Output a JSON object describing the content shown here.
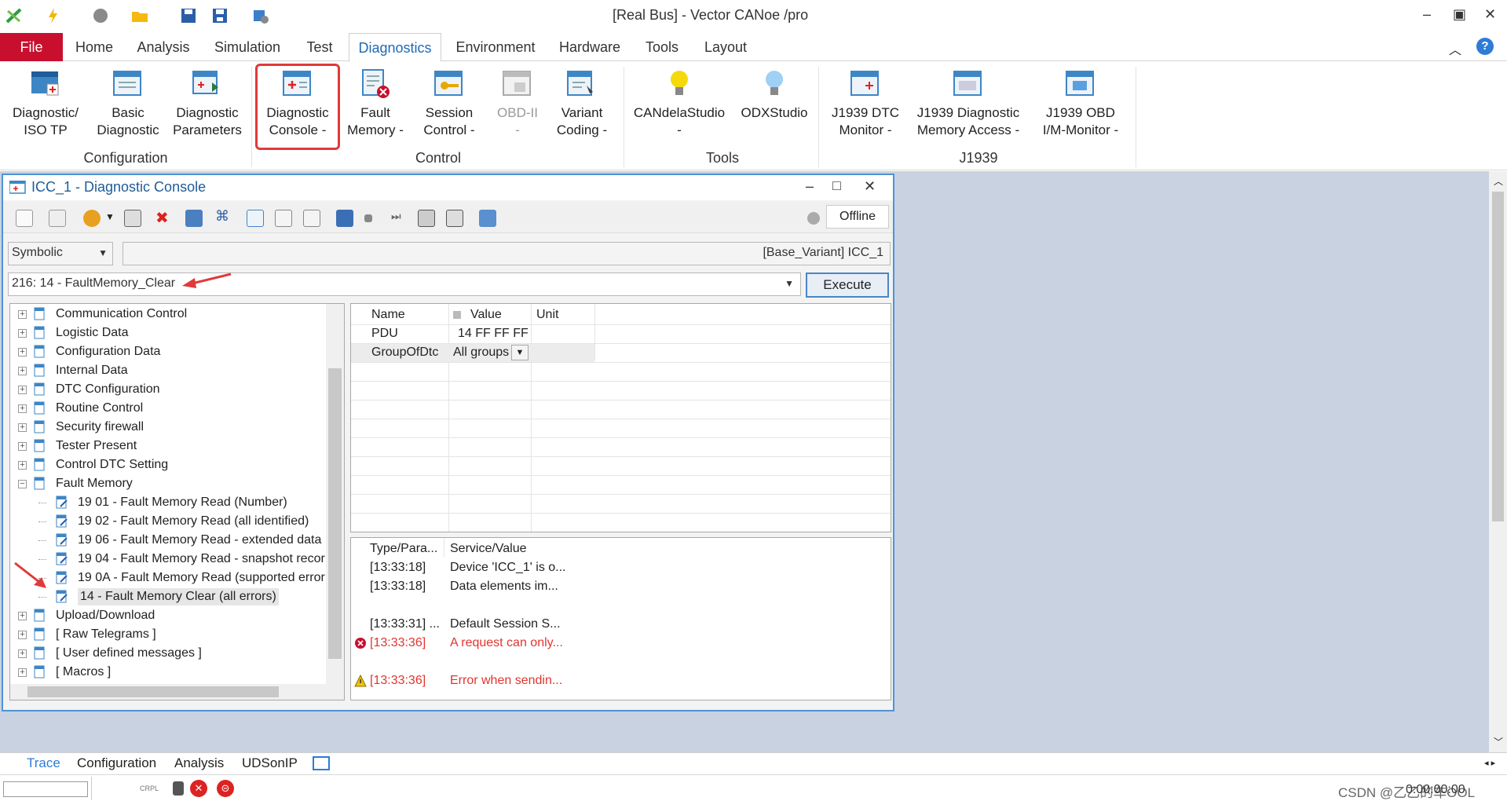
{
  "window": {
    "title": "[Real Bus] - Vector CANoe /pro"
  },
  "ribbon_tabs": [
    "File",
    "Home",
    "Analysis",
    "Simulation",
    "Test",
    "Diagnostics",
    "Environment",
    "Hardware",
    "Tools",
    "Layout"
  ],
  "ribbon": {
    "buttons": [
      {
        "l1": "Diagnostic/",
        "l2": "ISO TP"
      },
      {
        "l1": "Basic",
        "l2": "Diagnostic"
      },
      {
        "l1": "Diagnostic",
        "l2": "Parameters"
      },
      {
        "l1": "Diagnostic",
        "l2": "Console -"
      },
      {
        "l1": "Fault",
        "l2": "Memory -"
      },
      {
        "l1": "Session",
        "l2": "Control -"
      },
      {
        "l1": "OBD-II",
        "l2": "-"
      },
      {
        "l1": "Variant",
        "l2": "Coding -"
      },
      {
        "l1": "CANdelaStudio",
        "l2": "-"
      },
      {
        "l1": "ODXStudio",
        "l2": ""
      },
      {
        "l1": "J1939 DTC",
        "l2": "Monitor -"
      },
      {
        "l1": "J1939 Diagnostic",
        "l2": "Memory Access -"
      },
      {
        "l1": "J1939 OBD",
        "l2": "I/M-Monitor -"
      }
    ],
    "groups": [
      "Configuration",
      "Control",
      "Tools",
      "J1939"
    ]
  },
  "console": {
    "title": "ICC_1 - Diagnostic Console",
    "status": "Offline",
    "mode": "Symbolic",
    "variant": "[Base_Variant] ICC_1",
    "request": "216: 14 - FaultMemory_Clear",
    "execute": "Execute",
    "win_minimize": "–",
    "win_maximize": "□",
    "win_close": "✕"
  },
  "tree": [
    {
      "label": "Communication Control",
      "lvl": 0
    },
    {
      "label": "Logistic Data",
      "lvl": 0
    },
    {
      "label": "Configuration Data",
      "lvl": 0
    },
    {
      "label": "Internal Data",
      "lvl": 0
    },
    {
      "label": "DTC Configuration",
      "lvl": 0
    },
    {
      "label": "Routine Control",
      "lvl": 0
    },
    {
      "label": "Security firewall",
      "lvl": 0
    },
    {
      "label": "Tester Present",
      "lvl": 0
    },
    {
      "label": "Control DTC Setting",
      "lvl": 0
    },
    {
      "label": "Fault Memory",
      "lvl": 0
    },
    {
      "label": "19 01 - Fault Memory Read (Number)",
      "lvl": 1
    },
    {
      "label": "19 02 - Fault Memory Read (all identified)",
      "lvl": 1
    },
    {
      "label": "19 06 - Fault Memory Read - extended data",
      "lvl": 1
    },
    {
      "label": "19 04 - Fault Memory Read - snapshot recor",
      "lvl": 1
    },
    {
      "label": "19 0A - Fault Memory Read (supported error",
      "lvl": 1
    },
    {
      "label": "14 - Fault Memory Clear (all errors)",
      "lvl": 1
    },
    {
      "label": "Upload/Download",
      "lvl": 0
    },
    {
      "label": "[ Raw Telegrams ]",
      "lvl": 0
    },
    {
      "label": "[ User defined messages ]",
      "lvl": 0
    },
    {
      "label": "[ Macros ]",
      "lvl": 0
    }
  ],
  "grid": {
    "headers": [
      "Name",
      "Value",
      "Unit"
    ],
    "rows": [
      {
        "name": "PDU",
        "value": "14 FF FF FF",
        "unit": ""
      },
      {
        "name": "GroupOfDtc",
        "value": "All groups",
        "unit": ""
      }
    ]
  },
  "log": {
    "headers": [
      "Type/Para...",
      "Service/Value"
    ],
    "rows": [
      {
        "t": "[13:33:18]",
        "v": "Device 'ICC_1' is o...",
        "s": ""
      },
      {
        "t": "[13:33:18]",
        "v": "Data elements im...",
        "s": ""
      },
      {
        "t": "",
        "v": "",
        "s": ""
      },
      {
        "t": "[13:33:31] ...",
        "v": "Default Session S...",
        "s": ""
      },
      {
        "t": "[13:33:36]",
        "v": "A request can only...",
        "s": "error"
      },
      {
        "t": "",
        "v": "",
        "s": ""
      },
      {
        "t": "[13:33:36]",
        "v": "Error when sendin...",
        "s": "warning"
      }
    ]
  },
  "bottom_tabs": [
    "Trace",
    "Configuration",
    "Analysis",
    "UDSonIP"
  ],
  "status": {
    "time": "0:00:00:00",
    "kbd": "CRPL",
    "watermark": "CSDN @乙乙的车OOL"
  },
  "colors": {
    "file_tab": "#c8102e",
    "accent": "#1f6ab5",
    "highlight": "#e03a3a",
    "workspace": "#c9d2e0"
  }
}
